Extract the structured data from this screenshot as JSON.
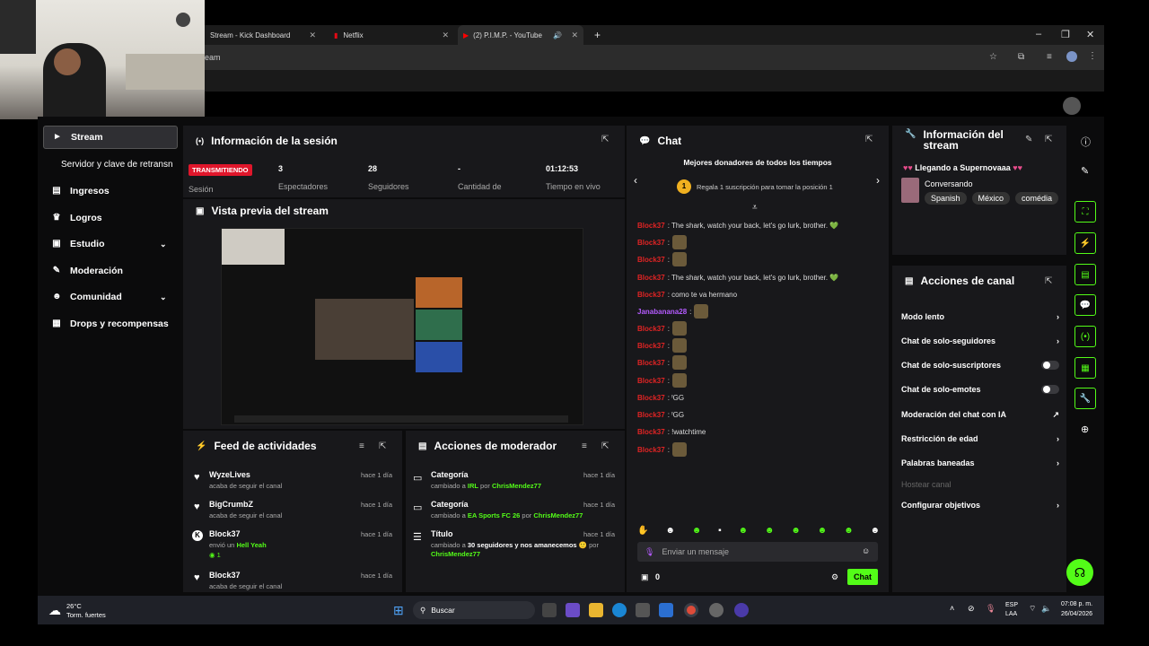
{
  "browser": {
    "tabs": [
      {
        "title": "Stream - Kick Dashboard"
      },
      {
        "title": "Netflix"
      },
      {
        "title": "(2) P.I.M.P. - YouTube"
      }
    ],
    "new_tab": "+",
    "address": "eam"
  },
  "sidebar": {
    "items": [
      {
        "label": "Stream",
        "icon": "►"
      },
      {
        "label": "Servidor y clave de retransn"
      },
      {
        "label": "Ingresos",
        "icon": "▤"
      },
      {
        "label": "Logros",
        "icon": "♛"
      },
      {
        "label": "Estudio",
        "icon": "▣"
      },
      {
        "label": "Moderación",
        "icon": "✎"
      },
      {
        "label": "Comunidad",
        "icon": "☻"
      },
      {
        "label": "Drops y recompensas",
        "icon": "▦"
      }
    ]
  },
  "session": {
    "title": "Información de la sesión",
    "badge": "TRANSMITIENDO",
    "badge_sub": "Sesión",
    "stats": [
      {
        "value": "3",
        "label": "Espectadores"
      },
      {
        "value": "28",
        "label": "Seguidores"
      },
      {
        "value": "-",
        "label": "Cantidad de"
      },
      {
        "value": "01:12:53",
        "label": "Tiempo en vivo"
      }
    ]
  },
  "preview": {
    "title": "Vista previa del stream"
  },
  "feed": {
    "title": "Feed de actividades",
    "items": [
      {
        "name": "WyzeLives",
        "sub": "acaba de seguir el canal",
        "time": "hace 1 día"
      },
      {
        "name": "BigCrumbZ",
        "sub": "acaba de seguir el canal",
        "time": "hace 1 día"
      },
      {
        "name": "Block37",
        "sub_pre": "envió un ",
        "sub_hl": "Hell Yeah",
        "count": "1",
        "time": "hace 1 día"
      },
      {
        "name": "Block37",
        "sub": "acaba de seguir el canal",
        "time": "hace 1 día"
      }
    ]
  },
  "modactions": {
    "title": "Acciones de moderador",
    "items": [
      {
        "name": "Categoría",
        "pre": "cambiado a ",
        "hl": "IRL",
        "mid": " por ",
        "by": "ChrisMendez77",
        "time": "hace 1 día"
      },
      {
        "name": "Categoría",
        "pre": "cambiado a ",
        "hl": "EA Sports FC 26",
        "mid": " por ",
        "by": "ChrisMendez77",
        "time": "hace 1 día"
      },
      {
        "name": "Título",
        "pre": "cambiado a ",
        "hl": "30 seguidores y nos amanecemos 🙂",
        "mid": " por",
        "by": "ChrisMendez77",
        "time": "hace 1 día"
      }
    ]
  },
  "chat": {
    "title": "Chat",
    "donors_title": "Mejores donadores de todos los tiempos",
    "donors_rank": "1",
    "donors_text": "Regala 1 suscripción para tomar la posición 1",
    "messages": [
      {
        "user": "Block37",
        "text": ": The shark, watch your back, let's go lurk, brother. 💚"
      },
      {
        "user": "Block37",
        "text": ":",
        "emote": true
      },
      {
        "user": "Block37",
        "text": ":",
        "emote": true
      },
      {
        "user": "Block37",
        "text": ": The shark, watch your back, let's go lurk, brother. 💚"
      },
      {
        "user": "Block37",
        "text": ": como te va hermano"
      },
      {
        "user": "Janabanana28",
        "text": ":",
        "emote": true,
        "purple": true
      },
      {
        "user": "Block37",
        "text": ":",
        "emote": true
      },
      {
        "user": "Block37",
        "text": ":",
        "emote": true
      },
      {
        "user": "Block37",
        "text": ":",
        "emote": true
      },
      {
        "user": "Block37",
        "text": ":",
        "emote": true
      },
      {
        "user": "Block37",
        "text": ": ꞋGG"
      },
      {
        "user": "Block37",
        "text": ": ꞋGG"
      },
      {
        "user": "Block37",
        "text": ": !watchtime"
      },
      {
        "user": "Block37",
        "text": ":",
        "emote": true
      }
    ],
    "input_placeholder": "Enviar un mensaje",
    "points": "0",
    "send_label": "Chat"
  },
  "channel_info": {
    "title": "Información del stream",
    "stream_title": "Llegando a Supernovaaa",
    "category": "Conversando",
    "tags": [
      "Spanish",
      "México",
      "comédia"
    ]
  },
  "channel_actions": {
    "title": "Acciones de canal",
    "items": [
      {
        "label": "Modo lento",
        "kind": "arrow"
      },
      {
        "label": "Chat de solo-seguidores",
        "kind": "arrow"
      },
      {
        "label": "Chat de solo-suscriptores",
        "kind": "toggle"
      },
      {
        "label": "Chat de solo-emotes",
        "kind": "toggle"
      },
      {
        "label": "Moderación del chat con IA",
        "kind": "ext"
      },
      {
        "label": "Restricción de edad",
        "kind": "arrow"
      },
      {
        "label": "Palabras baneadas",
        "kind": "arrow"
      },
      {
        "label": "Hostear canal",
        "kind": "disabled"
      },
      {
        "label": "Configurar objetivos",
        "kind": "arrow"
      }
    ]
  },
  "taskbar": {
    "weather_temp": "26°C",
    "weather_desc": "Torm. fuertes",
    "search": "Buscar",
    "lang1": "ESP",
    "lang2": "LAA",
    "time": "07:08 p. m.",
    "date": "26/04/2026"
  },
  "colors": {
    "accent": "#53fc18",
    "live": "#e0162b"
  }
}
